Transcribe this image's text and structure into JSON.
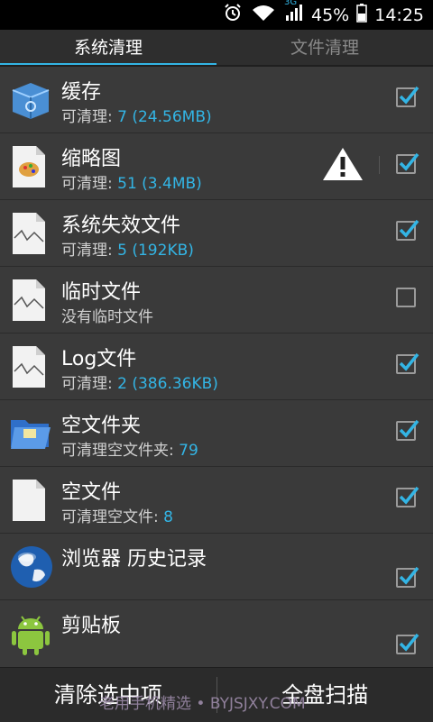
{
  "status": {
    "battery": "45%",
    "time": "14:25",
    "network": "3G"
  },
  "tabs": [
    {
      "label": "系统清理",
      "active": true
    },
    {
      "label": "文件清理",
      "active": false
    }
  ],
  "items": [
    {
      "title": "缓存",
      "sub_label": "可清理: ",
      "sub_value": "7 (24.56MB)",
      "checked": true,
      "icon": "cache-box-icon"
    },
    {
      "title": "缩略图",
      "sub_label": "可清理: ",
      "sub_value": "51 (3.4MB)",
      "checked": true,
      "warning": true,
      "icon": "thumbnail-file-icon"
    },
    {
      "title": "系统失效文件",
      "sub_label": "可清理: ",
      "sub_value": "5 (192KB)",
      "checked": true,
      "icon": "broken-file-icon"
    },
    {
      "title": "临时文件",
      "sub_label": "没有临时文件",
      "sub_value": "",
      "checked": false,
      "icon": "broken-file-icon"
    },
    {
      "title": "Log文件",
      "sub_label": "可清理: ",
      "sub_value": "2 (386.36KB)",
      "checked": true,
      "icon": "broken-file-icon"
    },
    {
      "title": "空文件夹",
      "sub_label": "可清理空文件夹: ",
      "sub_value": "79",
      "checked": true,
      "icon": "folder-icon"
    },
    {
      "title": "空文件",
      "sub_label": "可清理空文件: ",
      "sub_value": "8",
      "checked": true,
      "icon": "blank-file-icon"
    },
    {
      "title": "浏览器 历史记录",
      "sub_label": "",
      "sub_value": "",
      "checked": true,
      "icon": "globe-icon"
    },
    {
      "title": "剪贴板",
      "sub_label": "",
      "sub_value": "",
      "checked": true,
      "icon": "android-icon"
    }
  ],
  "bottom": {
    "clear_label": "清除选中项",
    "scan_label": "全盘扫描"
  },
  "watermark": "老用手机精选 • BYJSJXY.COM",
  "colors": {
    "accent": "#33b5e5",
    "background": "#3a3a3a"
  }
}
